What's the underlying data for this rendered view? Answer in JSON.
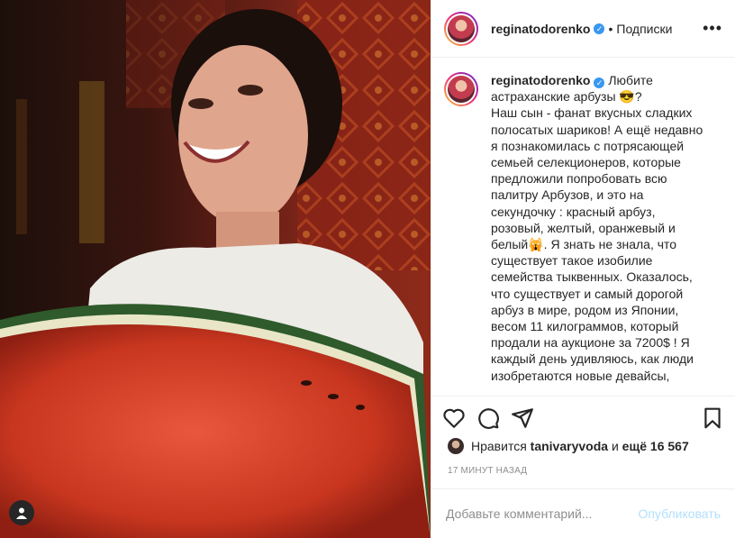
{
  "header": {
    "username": "reginatodorenko",
    "separator": "•",
    "follow_status": "Подписки",
    "more_icon": "more-horizontal-icon"
  },
  "caption": {
    "username": "reginatodorenko",
    "lines": [
      "Любите",
      "астраханские арбузы 😎?",
      "Наш сын - фанат вкусных сладких",
      "полосатых шариков! А ещё недавно",
      "я познакомилась с потрясающей",
      "семьей селекционеров, которые",
      "предложили попробовать всю",
      "палитру Арбузов, и это на",
      "секундочку : красный арбуз,",
      "розовый, желтый, оранжевый и",
      "белый🙀. Я знать не знала, что",
      "существует такое изобилие",
      "семейства тыквенных. Оказалось,",
      "что существует и самый дорогой",
      "арбуз в мире, родом из Японии,",
      "весом 11 килограммов, который",
      "продали на аукционе за 7200$ ! Я",
      "каждый день удивляюсь, как люди",
      "изобретаются новые девайсы,"
    ]
  },
  "actions": {
    "like_icon": "heart-icon",
    "comment_icon": "comment-icon",
    "share_icon": "share-icon",
    "save_icon": "bookmark-icon"
  },
  "likes": {
    "prefix": "Нравится",
    "user": "tanivaryvoda",
    "middle": "и",
    "count": "ещё 16 567"
  },
  "timestamp": "17 МИНУТ НАЗАД",
  "comment_box": {
    "placeholder": "Добавьте комментарий...",
    "publish_label": "Опубликовать"
  },
  "colors": {
    "accent": "#3897f0",
    "publish_disabled": "#b2dffc",
    "meta_text": "#8e8e8e"
  }
}
